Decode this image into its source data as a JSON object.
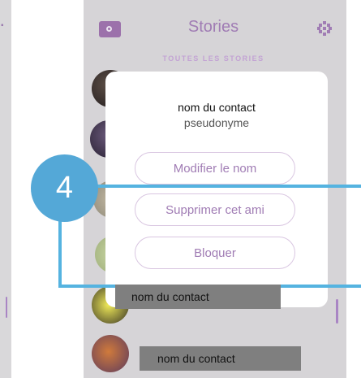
{
  "header": {
    "title": "Stories",
    "section": "TOUTES LES STORIES"
  },
  "modal": {
    "contact_name": "nom du contact",
    "pseudonym": "pseudonyme",
    "buttons": {
      "rename": "Modifier le nom",
      "remove": "Supprimer cet ami",
      "block": "Bloquer"
    }
  },
  "labels": {
    "row1": "nom du contact",
    "row2": "nom du contact"
  },
  "callout": {
    "number": "4",
    "color": "#54a8d7"
  },
  "colors": {
    "accent": "#a07cb4",
    "background": "#d6d4d7"
  },
  "icons": [
    "camera-icon",
    "grid-icon"
  ]
}
